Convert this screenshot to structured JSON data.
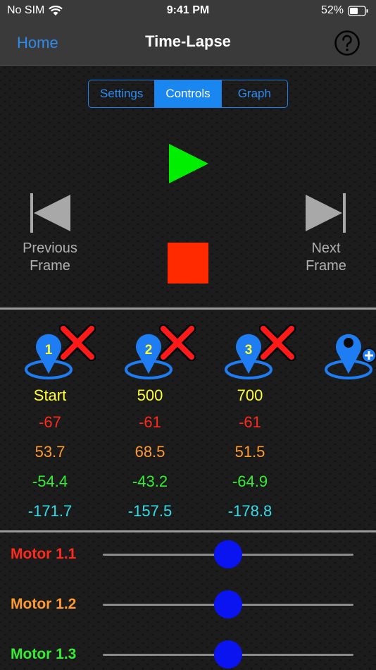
{
  "status": {
    "carrier": "No SIM",
    "time": "9:41 PM",
    "battery": "52%"
  },
  "nav": {
    "back_label": "Home",
    "title": "Time-Lapse",
    "help_icon": "help-circle-icon"
  },
  "tabs": [
    {
      "label": "Settings",
      "active": false
    },
    {
      "label": "Controls",
      "active": true
    },
    {
      "label": "Graph",
      "active": false
    }
  ],
  "controls": {
    "prev_line1": "Previous",
    "prev_line2": "Frame",
    "next_line1": "Next",
    "next_line2": "Frame",
    "play_color": "#00ee00",
    "stop_color": "#ff2a00"
  },
  "keyframes": [
    {
      "number": "1",
      "label": "Start",
      "values": [
        "-67",
        "53.7",
        "-54.4",
        "-171.7"
      ]
    },
    {
      "number": "2",
      "label": "500",
      "values": [
        "-61",
        "68.5",
        "-43.2",
        "-157.5"
      ]
    },
    {
      "number": "3",
      "label": "700",
      "values": [
        "-61",
        "51.5",
        "-64.9",
        "-178.8"
      ]
    }
  ],
  "motors": [
    {
      "label": "Motor 1.1",
      "color": "#ff2a1a",
      "level": 0.5
    },
    {
      "label": "Motor 1.2",
      "color": "#ff9a2e",
      "level": 0.5
    },
    {
      "label": "Motor 1.3",
      "color": "#33ee33",
      "level": 0.5
    }
  ]
}
